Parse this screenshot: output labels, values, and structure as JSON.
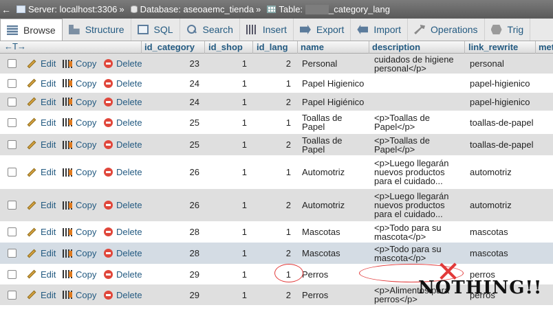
{
  "breadcrumb": {
    "back_arrow": "←",
    "server": "Server: localhost:3306",
    "database": "Database: aseoaemc_tienda",
    "table_prefix": "Table:",
    "table": "_category_lang",
    "sep": "»"
  },
  "tabs": [
    {
      "label": "Browse",
      "icon": "browse-icon"
    },
    {
      "label": "Structure",
      "icon": "structure-icon"
    },
    {
      "label": "SQL",
      "icon": "sql-icon"
    },
    {
      "label": "Search",
      "icon": "search-icon"
    },
    {
      "label": "Insert",
      "icon": "insert-icon"
    },
    {
      "label": "Export",
      "icon": "export-icon"
    },
    {
      "label": "Import",
      "icon": "import-icon"
    },
    {
      "label": "Operations",
      "icon": "operations-icon"
    },
    {
      "label": "Trig",
      "icon": "triggers-icon"
    }
  ],
  "table": {
    "arrows": "←T→",
    "columns": [
      "id_category",
      "id_shop",
      "id_lang",
      "name",
      "description",
      "link_rewrite",
      "met"
    ],
    "actions": {
      "edit": "Edit",
      "copy": "Copy",
      "delete": "Delete"
    },
    "rows": [
      {
        "id_category": "23",
        "id_shop": "1",
        "id_lang": "2",
        "name": "Personal",
        "description": "cuidados de higiene personal</p>",
        "link_rewrite": "personal"
      },
      {
        "id_category": "24",
        "id_shop": "1",
        "id_lang": "1",
        "name": "Papel Higienico",
        "description": "",
        "link_rewrite": "papel-higienico"
      },
      {
        "id_category": "24",
        "id_shop": "1",
        "id_lang": "2",
        "name": "Papel Higiénico",
        "description": "",
        "link_rewrite": "papel-higienico"
      },
      {
        "id_category": "25",
        "id_shop": "1",
        "id_lang": "1",
        "name": "Toallas de Papel",
        "description": "<p>Toallas de Papel</p>",
        "link_rewrite": "toallas-de-papel"
      },
      {
        "id_category": "25",
        "id_shop": "1",
        "id_lang": "2",
        "name": "Toallas de Papel",
        "description": "<p>Toallas de Papel</p>",
        "link_rewrite": "toallas-de-papel"
      },
      {
        "id_category": "26",
        "id_shop": "1",
        "id_lang": "1",
        "name": "Automotriz",
        "description": "<p>Luego llegarán nuevos productos para el cuidado...",
        "link_rewrite": "automotriz"
      },
      {
        "id_category": "26",
        "id_shop": "1",
        "id_lang": "2",
        "name": "Automotriz",
        "description": "<p>Luego llegarán nuevos productos para el cuidado...",
        "link_rewrite": "automotriz"
      },
      {
        "id_category": "28",
        "id_shop": "1",
        "id_lang": "1",
        "name": "Mascotas",
        "description": "<p>Todo para su mascota</p>",
        "link_rewrite": "mascotas"
      },
      {
        "id_category": "28",
        "id_shop": "1",
        "id_lang": "2",
        "name": "Mascotas",
        "description": "<p>Todo para su mascota</p>",
        "link_rewrite": "mascotas"
      },
      {
        "id_category": "29",
        "id_shop": "1",
        "id_lang": "1",
        "name": "Perros",
        "description": "",
        "link_rewrite": "perros"
      },
      {
        "id_category": "29",
        "id_shop": "1",
        "id_lang": "2",
        "name": "Perros",
        "description": "<p>Alimentos para perros</p>",
        "link_rewrite": "perros"
      }
    ]
  },
  "annotation": {
    "text": "NOTHING!!",
    "xmark": "✕",
    "color": "#e23a3a"
  }
}
